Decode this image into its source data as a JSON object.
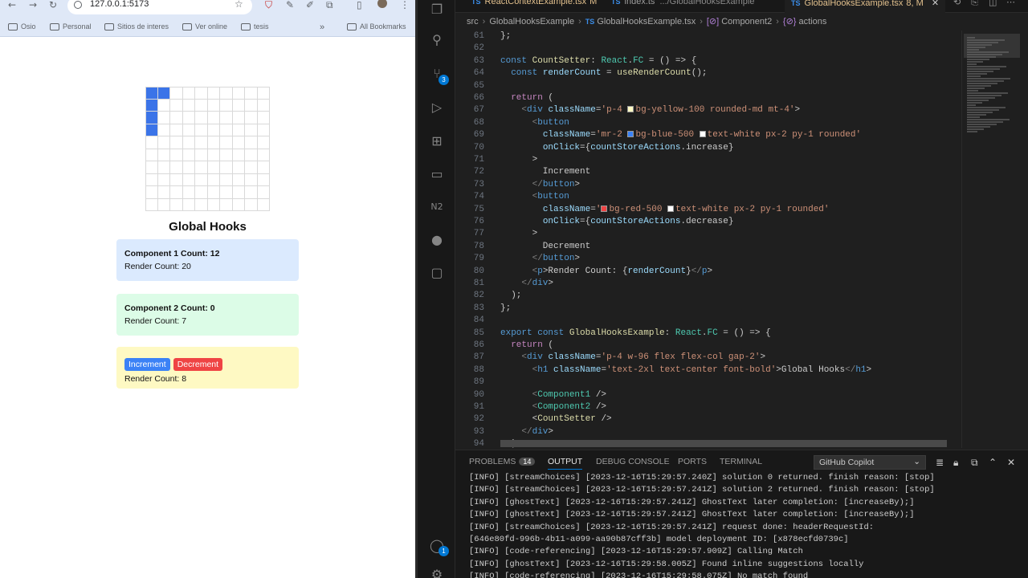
{
  "browser": {
    "url": "127.0.0.1:5173",
    "bookmarks": [
      "Osio",
      "Personal",
      "Sitios de interes",
      "Ver online",
      "tesis"
    ],
    "all_bookmarks": "All Bookmarks"
  },
  "app": {
    "grid_filled_cells": [
      [
        0,
        0
      ],
      [
        1,
        0
      ],
      [
        0,
        1
      ],
      [
        0,
        2
      ],
      [
        0,
        3
      ]
    ],
    "title": "Global Hooks",
    "component1": {
      "count": "Component 1 Count: 12",
      "render": "Render Count: 20"
    },
    "component2": {
      "count": "Component 2 Count: 0",
      "render": "Render Count: 7"
    },
    "setter": {
      "increment": "Increment",
      "decrement": "Decrement",
      "render": "Render Count: 8"
    }
  },
  "vscode": {
    "tabs": [
      {
        "name": "ReactContextExample.tsx",
        "mod": "M",
        "meta": ""
      },
      {
        "name": "index.ts",
        "mod": "",
        "meta": ".../GlobalHooksExample"
      },
      {
        "name": "GlobalHooksExample.tsx",
        "mod": "8, M",
        "meta": ""
      }
    ],
    "breadcrumbs": [
      "src",
      "GlobalHooksExample",
      "GlobalHooksExample.tsx",
      "Component2",
      "actions"
    ],
    "source_control_badge": "3",
    "accounts_badge": "1",
    "panel": {
      "tabs": [
        "PROBLEMS",
        "OUTPUT",
        "DEBUG CONSOLE",
        "PORTS",
        "TERMINAL"
      ],
      "problems_count": "14",
      "output_channel": "GitHub Copilot",
      "lines": [
        "[INFO] [streamChoices] [2023-12-16T15:29:57.240Z] solution 0 returned. finish reason: [stop]",
        "[INFO] [streamChoices] [2023-12-16T15:29:57.241Z] solution 2 returned. finish reason: [stop]",
        "[INFO] [ghostText] [2023-12-16T15:29:57.241Z] GhostText later completion: [increaseBy);]",
        "[INFO] [ghostText] [2023-12-16T15:29:57.241Z] GhostText later completion: [increaseBy);]",
        "[INFO] [streamChoices] [2023-12-16T15:29:57.241Z] request done: headerRequestId:",
        "[646e80fd-996b-4b11-a099-aa90b87cff3b] model deployment ID: [x878ecfd0739c]",
        "[INFO] [code-referencing] [2023-12-16T15:29:57.909Z] Calling Match",
        "[INFO] [ghostText] [2023-12-16T15:29:58.005Z] Found inline suggestions locally",
        "[INFO] [code-referencing] [2023-12-16T15:29:58.075Z] No match found"
      ]
    },
    "code": [
      {
        "n": "61",
        "t": "};"
      },
      {
        "n": "62",
        "t": ""
      },
      {
        "n": "63",
        "t": "const CountSetter: React.FC = () => {"
      },
      {
        "n": "64",
        "t": "  const renderCount = useRenderCount();"
      },
      {
        "n": "65",
        "t": ""
      },
      {
        "n": "66",
        "t": "  return ("
      },
      {
        "n": "67",
        "t": "    <div className='p-4 bg-yellow-100 rounded-md mt-4'>"
      },
      {
        "n": "68",
        "t": "      <button"
      },
      {
        "n": "69",
        "t": "        className='mr-2 bg-blue-500 text-white px-2 py-1 rounded'"
      },
      {
        "n": "70",
        "t": "        onClick={countStoreActions.increase}"
      },
      {
        "n": "71",
        "t": "      >"
      },
      {
        "n": "72",
        "t": "        Increment"
      },
      {
        "n": "73",
        "t": "      </button>"
      },
      {
        "n": "74",
        "t": "      <button"
      },
      {
        "n": "75",
        "t": "        className='bg-red-500 text-white px-2 py-1 rounded'"
      },
      {
        "n": "76",
        "t": "        onClick={countStoreActions.decrease}"
      },
      {
        "n": "77",
        "t": "      >"
      },
      {
        "n": "78",
        "t": "        Decrement"
      },
      {
        "n": "79",
        "t": "      </button>"
      },
      {
        "n": "80",
        "t": "      <p>Render Count: {renderCount}</p>"
      },
      {
        "n": "81",
        "t": "    </div>"
      },
      {
        "n": "82",
        "t": "  );"
      },
      {
        "n": "83",
        "t": "};"
      },
      {
        "n": "84",
        "t": ""
      },
      {
        "n": "85",
        "t": "export const GlobalHooksExample: React.FC = () => {"
      },
      {
        "n": "86",
        "t": "  return ("
      },
      {
        "n": "87",
        "t": "    <div className='p-4 w-96 flex flex-col gap-2'>"
      },
      {
        "n": "88",
        "t": "      <h1 className='text-2xl text-center font-bold'>Global Hooks</h1>"
      },
      {
        "n": "89",
        "t": ""
      },
      {
        "n": "90",
        "t": "      <Component1 />"
      },
      {
        "n": "91",
        "t": "      <Component2 />"
      },
      {
        "n": "92",
        "t": "      <CountSetter />"
      },
      {
        "n": "93",
        "t": "    </div>"
      },
      {
        "n": "94",
        "t": "  );"
      }
    ]
  }
}
